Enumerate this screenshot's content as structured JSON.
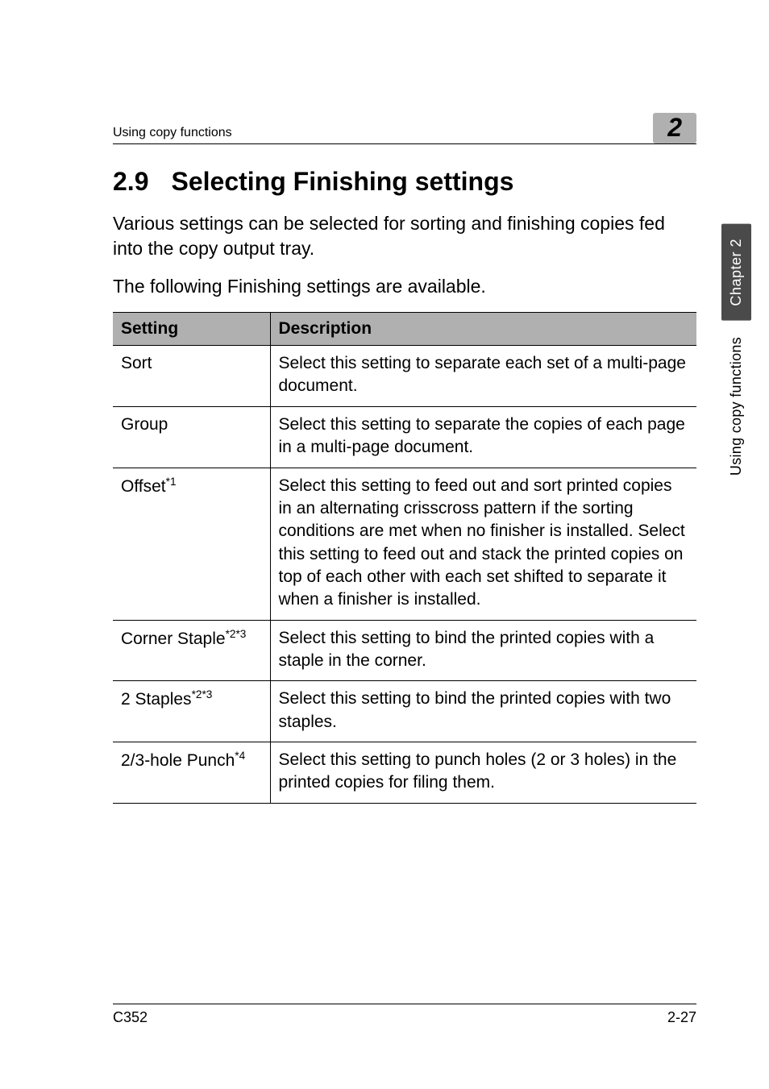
{
  "header": {
    "running_title": "Using copy functions",
    "badge": "2"
  },
  "section": {
    "number": "2.9",
    "title": "Selecting Finishing settings"
  },
  "paragraphs": {
    "p1": "Various settings can be selected for sorting and finishing copies fed into the copy output tray.",
    "p2": "The following Finishing settings are available."
  },
  "table": {
    "headers": {
      "setting": "Setting",
      "description": "Description"
    },
    "rows": [
      {
        "setting_html": "Sort",
        "description": "Select this setting to separate each set of a multi-page document."
      },
      {
        "setting_html": "Group",
        "description": "Select this setting to separate the copies of each page in a multi-page document."
      },
      {
        "setting_html": "Offset<sup>*1</sup>",
        "description": "Select this setting to feed out and sort printed copies in an alternating crisscross pattern if the sorting conditions are met when no finisher is installed.\nSelect this setting to feed out and stack the printed copies on top of each other with each set shifted to separate it when a finisher is installed."
      },
      {
        "setting_html": "Corner Staple<sup>*2*3</sup>",
        "description": "Select this setting to bind the printed copies with a staple in the corner."
      },
      {
        "setting_html": "2 Staples<sup>*2*3</sup>",
        "description": "Select this setting to bind the printed copies with two staples."
      },
      {
        "setting_html": "2/3-hole Punch<sup>*4</sup>",
        "description": "Select this setting to punch holes (2 or 3 holes) in the printed copies for filing them."
      }
    ]
  },
  "side_tab": {
    "chapter": "Chapter 2",
    "section": "Using copy functions"
  },
  "footer": {
    "model": "C352",
    "page": "2-27"
  }
}
